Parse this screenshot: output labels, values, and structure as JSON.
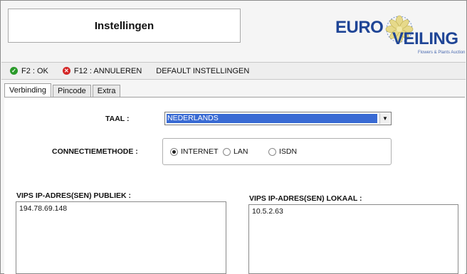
{
  "header": {
    "title": "Instellingen",
    "logo": {
      "word1": "EURO",
      "word2": "VEILING",
      "tagline": "Flowers & Plants Auction"
    }
  },
  "toolbar": {
    "ok_label": "F2 : OK",
    "cancel_label": "F12 : ANNULEREN",
    "default_label": "DEFAULT INSTELLINGEN"
  },
  "tabs": [
    {
      "label": "Verbinding",
      "active": true
    },
    {
      "label": "Pincode",
      "active": false
    },
    {
      "label": "Extra",
      "active": false
    }
  ],
  "form": {
    "language_label": "TAAL :",
    "language_value": "NEDERLANDS",
    "connection_label": "CONNECTIEMETHODE :",
    "connection_options": [
      "INTERNET",
      "LAN",
      "ISDN"
    ],
    "connection_selected": "INTERNET",
    "public_ip_label": "VIPS IP-ADRES(SEN) PUBLIEK :",
    "public_ip_value": "194.78.69.148",
    "local_ip_label": "VIPS IP-ADRES(SEN) LOKAAL :",
    "local_ip_value": "10.5.2.63"
  },
  "colors": {
    "brand": "#1f4596",
    "selection": "#3a6bd4"
  }
}
